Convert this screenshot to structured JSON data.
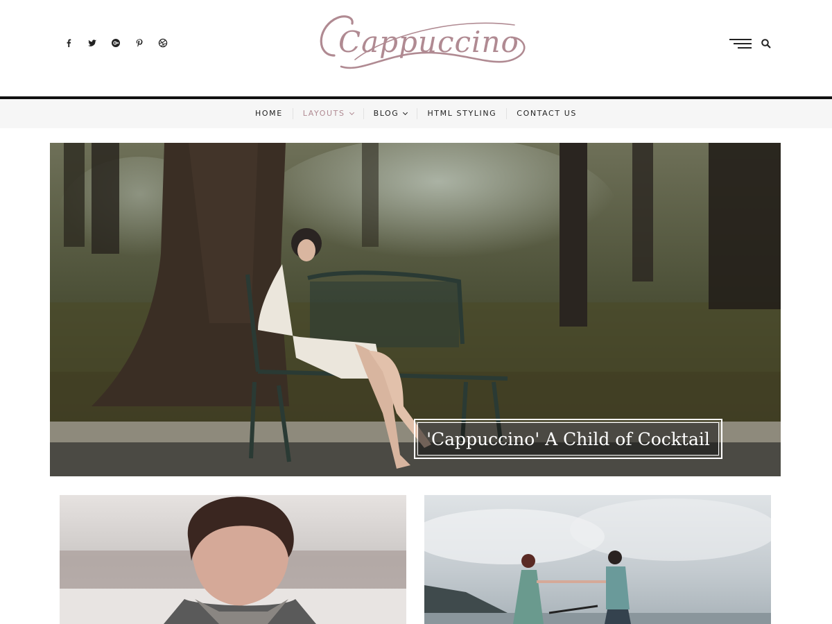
{
  "site": {
    "logo_text": "Cappuccino",
    "accent_color": "#b08a92"
  },
  "social": [
    {
      "icon": "facebook-icon",
      "glyph": "f"
    },
    {
      "icon": "twitter-icon",
      "glyph": "t"
    },
    {
      "icon": "google-plus-icon",
      "glyph": "g"
    },
    {
      "icon": "pinterest-icon",
      "glyph": "p"
    },
    {
      "icon": "dribbble-icon",
      "glyph": "d"
    }
  ],
  "header_actions": {
    "menu_icon": "hamburger-menu-icon",
    "search_icon": "search-icon"
  },
  "nav": {
    "items": [
      {
        "label": "HOME",
        "has_dropdown": false,
        "active": false
      },
      {
        "label": "LAYOUTS",
        "has_dropdown": true,
        "active": true
      },
      {
        "label": "BLOG",
        "has_dropdown": true,
        "active": false
      },
      {
        "label": "HTML STYLING",
        "has_dropdown": false,
        "active": false
      },
      {
        "label": "CONTACT US",
        "has_dropdown": false,
        "active": false
      }
    ]
  },
  "hero": {
    "caption": "'Cappuccino' A Child of Cocktail",
    "image": "woman-reading-on-park-bench"
  },
  "cards": [
    {
      "image": "young-man-in-snow"
    },
    {
      "image": "couple-holding-hands-with-bicycle"
    }
  ]
}
